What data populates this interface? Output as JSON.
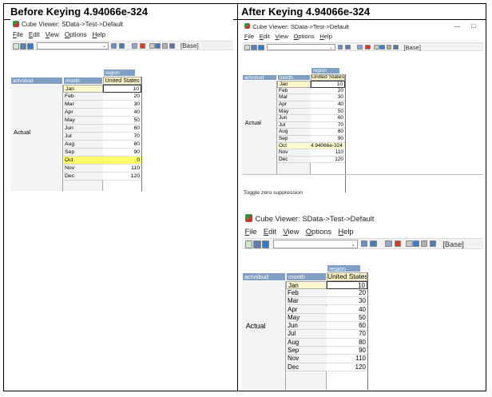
{
  "headers": {
    "left": "Before Keying 4.94066e-324",
    "right": "After Keying 4.94066e-324"
  },
  "window": {
    "title": "Cube Viewer: SData->Test->Default",
    "menu": [
      "File",
      "Edit",
      "View",
      "Options",
      "Help"
    ],
    "base_label": "[Base]",
    "min_glyph": "—",
    "max_glyph": "□"
  },
  "grid": {
    "dim_headers": {
      "region": "region",
      "actvsbud": "actvsbud",
      "month": "month"
    },
    "column": "United States",
    "row_label": "Actual",
    "months": [
      "Jan",
      "Feb",
      "Mar",
      "Apr",
      "May",
      "Jun",
      "Jul",
      "Aug",
      "Sep",
      "Oct",
      "Nov",
      "Dec"
    ],
    "before_values": [
      "10",
      "20",
      "30",
      "40",
      "50",
      "60",
      "70",
      "80",
      "90",
      "0",
      "110",
      "120"
    ],
    "after_values": [
      "10",
      "20",
      "30",
      "40",
      "50",
      "60",
      "70",
      "80",
      "90",
      "4.94066e-324",
      "110",
      "120"
    ],
    "suppressed_months": [
      "Jan",
      "Feb",
      "Mar",
      "Apr",
      "May",
      "Jun",
      "Jul",
      "Aug",
      "Sep",
      "Nov",
      "Dec"
    ],
    "suppressed_values": [
      "10",
      "20",
      "30",
      "40",
      "50",
      "60",
      "70",
      "80",
      "90",
      "110",
      "120"
    ]
  },
  "status_text": "Toggle zero suppression",
  "colors": {
    "dim_header": "#7f9fc4",
    "selection": "#fdf6cc",
    "highlight": "#fdfd6a"
  }
}
